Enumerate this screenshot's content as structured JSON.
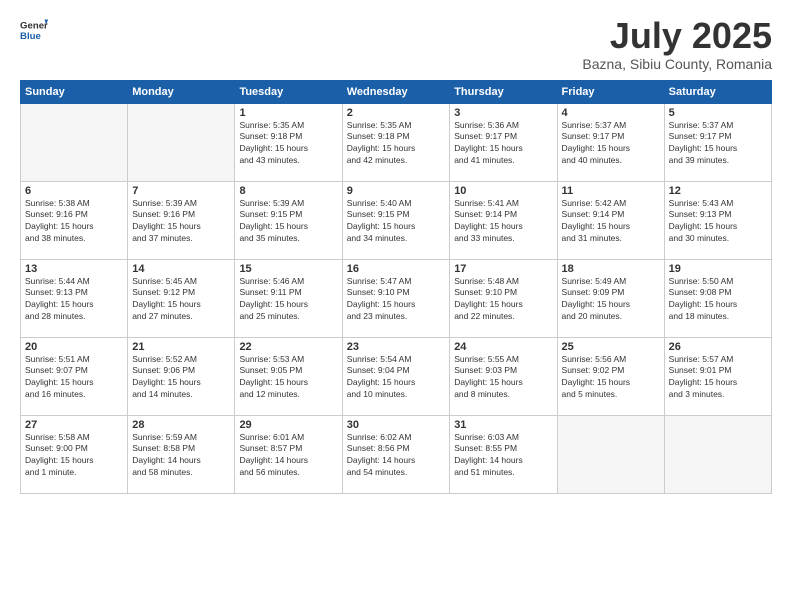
{
  "header": {
    "logo_general": "General",
    "logo_blue": "Blue",
    "title": "July 2025",
    "subtitle": "Bazna, Sibiu County, Romania"
  },
  "columns": [
    "Sunday",
    "Monday",
    "Tuesday",
    "Wednesday",
    "Thursday",
    "Friday",
    "Saturday"
  ],
  "weeks": [
    [
      {
        "day": "",
        "info": ""
      },
      {
        "day": "",
        "info": ""
      },
      {
        "day": "1",
        "info": "Sunrise: 5:35 AM\nSunset: 9:18 PM\nDaylight: 15 hours\nand 43 minutes."
      },
      {
        "day": "2",
        "info": "Sunrise: 5:35 AM\nSunset: 9:18 PM\nDaylight: 15 hours\nand 42 minutes."
      },
      {
        "day": "3",
        "info": "Sunrise: 5:36 AM\nSunset: 9:17 PM\nDaylight: 15 hours\nand 41 minutes."
      },
      {
        "day": "4",
        "info": "Sunrise: 5:37 AM\nSunset: 9:17 PM\nDaylight: 15 hours\nand 40 minutes."
      },
      {
        "day": "5",
        "info": "Sunrise: 5:37 AM\nSunset: 9:17 PM\nDaylight: 15 hours\nand 39 minutes."
      }
    ],
    [
      {
        "day": "6",
        "info": "Sunrise: 5:38 AM\nSunset: 9:16 PM\nDaylight: 15 hours\nand 38 minutes."
      },
      {
        "day": "7",
        "info": "Sunrise: 5:39 AM\nSunset: 9:16 PM\nDaylight: 15 hours\nand 37 minutes."
      },
      {
        "day": "8",
        "info": "Sunrise: 5:39 AM\nSunset: 9:15 PM\nDaylight: 15 hours\nand 35 minutes."
      },
      {
        "day": "9",
        "info": "Sunrise: 5:40 AM\nSunset: 9:15 PM\nDaylight: 15 hours\nand 34 minutes."
      },
      {
        "day": "10",
        "info": "Sunrise: 5:41 AM\nSunset: 9:14 PM\nDaylight: 15 hours\nand 33 minutes."
      },
      {
        "day": "11",
        "info": "Sunrise: 5:42 AM\nSunset: 9:14 PM\nDaylight: 15 hours\nand 31 minutes."
      },
      {
        "day": "12",
        "info": "Sunrise: 5:43 AM\nSunset: 9:13 PM\nDaylight: 15 hours\nand 30 minutes."
      }
    ],
    [
      {
        "day": "13",
        "info": "Sunrise: 5:44 AM\nSunset: 9:13 PM\nDaylight: 15 hours\nand 28 minutes."
      },
      {
        "day": "14",
        "info": "Sunrise: 5:45 AM\nSunset: 9:12 PM\nDaylight: 15 hours\nand 27 minutes."
      },
      {
        "day": "15",
        "info": "Sunrise: 5:46 AM\nSunset: 9:11 PM\nDaylight: 15 hours\nand 25 minutes."
      },
      {
        "day": "16",
        "info": "Sunrise: 5:47 AM\nSunset: 9:10 PM\nDaylight: 15 hours\nand 23 minutes."
      },
      {
        "day": "17",
        "info": "Sunrise: 5:48 AM\nSunset: 9:10 PM\nDaylight: 15 hours\nand 22 minutes."
      },
      {
        "day": "18",
        "info": "Sunrise: 5:49 AM\nSunset: 9:09 PM\nDaylight: 15 hours\nand 20 minutes."
      },
      {
        "day": "19",
        "info": "Sunrise: 5:50 AM\nSunset: 9:08 PM\nDaylight: 15 hours\nand 18 minutes."
      }
    ],
    [
      {
        "day": "20",
        "info": "Sunrise: 5:51 AM\nSunset: 9:07 PM\nDaylight: 15 hours\nand 16 minutes."
      },
      {
        "day": "21",
        "info": "Sunrise: 5:52 AM\nSunset: 9:06 PM\nDaylight: 15 hours\nand 14 minutes."
      },
      {
        "day": "22",
        "info": "Sunrise: 5:53 AM\nSunset: 9:05 PM\nDaylight: 15 hours\nand 12 minutes."
      },
      {
        "day": "23",
        "info": "Sunrise: 5:54 AM\nSunset: 9:04 PM\nDaylight: 15 hours\nand 10 minutes."
      },
      {
        "day": "24",
        "info": "Sunrise: 5:55 AM\nSunset: 9:03 PM\nDaylight: 15 hours\nand 8 minutes."
      },
      {
        "day": "25",
        "info": "Sunrise: 5:56 AM\nSunset: 9:02 PM\nDaylight: 15 hours\nand 5 minutes."
      },
      {
        "day": "26",
        "info": "Sunrise: 5:57 AM\nSunset: 9:01 PM\nDaylight: 15 hours\nand 3 minutes."
      }
    ],
    [
      {
        "day": "27",
        "info": "Sunrise: 5:58 AM\nSunset: 9:00 PM\nDaylight: 15 hours\nand 1 minute."
      },
      {
        "day": "28",
        "info": "Sunrise: 5:59 AM\nSunset: 8:58 PM\nDaylight: 14 hours\nand 58 minutes."
      },
      {
        "day": "29",
        "info": "Sunrise: 6:01 AM\nSunset: 8:57 PM\nDaylight: 14 hours\nand 56 minutes."
      },
      {
        "day": "30",
        "info": "Sunrise: 6:02 AM\nSunset: 8:56 PM\nDaylight: 14 hours\nand 54 minutes."
      },
      {
        "day": "31",
        "info": "Sunrise: 6:03 AM\nSunset: 8:55 PM\nDaylight: 14 hours\nand 51 minutes."
      },
      {
        "day": "",
        "info": ""
      },
      {
        "day": "",
        "info": ""
      }
    ]
  ]
}
